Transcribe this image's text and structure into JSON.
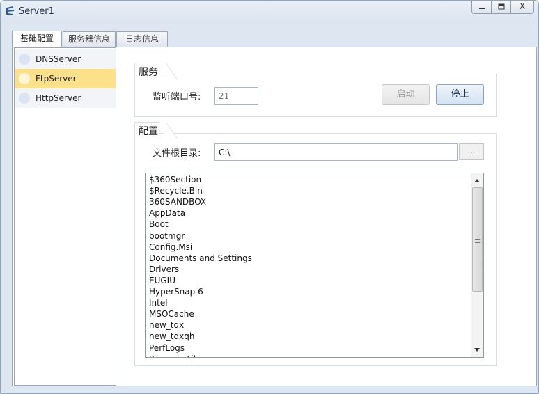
{
  "window": {
    "title": "Server1",
    "min_label": "—",
    "max_label": "☐",
    "close_label": "X"
  },
  "tabs": [
    {
      "label": "基础配置"
    },
    {
      "label": "服务器信息"
    },
    {
      "label": "日志信息"
    }
  ],
  "servers": [
    {
      "label": "DNSServer"
    },
    {
      "label": "FtpServer"
    },
    {
      "label": "HttpServer"
    }
  ],
  "service": {
    "title": "服务",
    "port_label": "监听端口号:",
    "port_value": "21",
    "start_label": "启动",
    "stop_label": "停止"
  },
  "config": {
    "title": "配置",
    "root_label": "文件根目录:",
    "root_value": "C:\\",
    "browse_label": "..."
  },
  "files": [
    "$360Section",
    "$Recycle.Bin",
    "360SANDBOX",
    "AppData",
    "Boot",
    "bootmgr",
    "Config.Msi",
    "Documents and Settings",
    "Drivers",
    "EUGIU",
    "HyperSnap 6",
    "Intel",
    "MSOCache",
    "new_tdx",
    "new_tdxqh",
    "PerfLogs",
    "Program Files"
  ],
  "colors": {
    "selected": "#fde18a",
    "window_bg": "#dde6f1"
  }
}
